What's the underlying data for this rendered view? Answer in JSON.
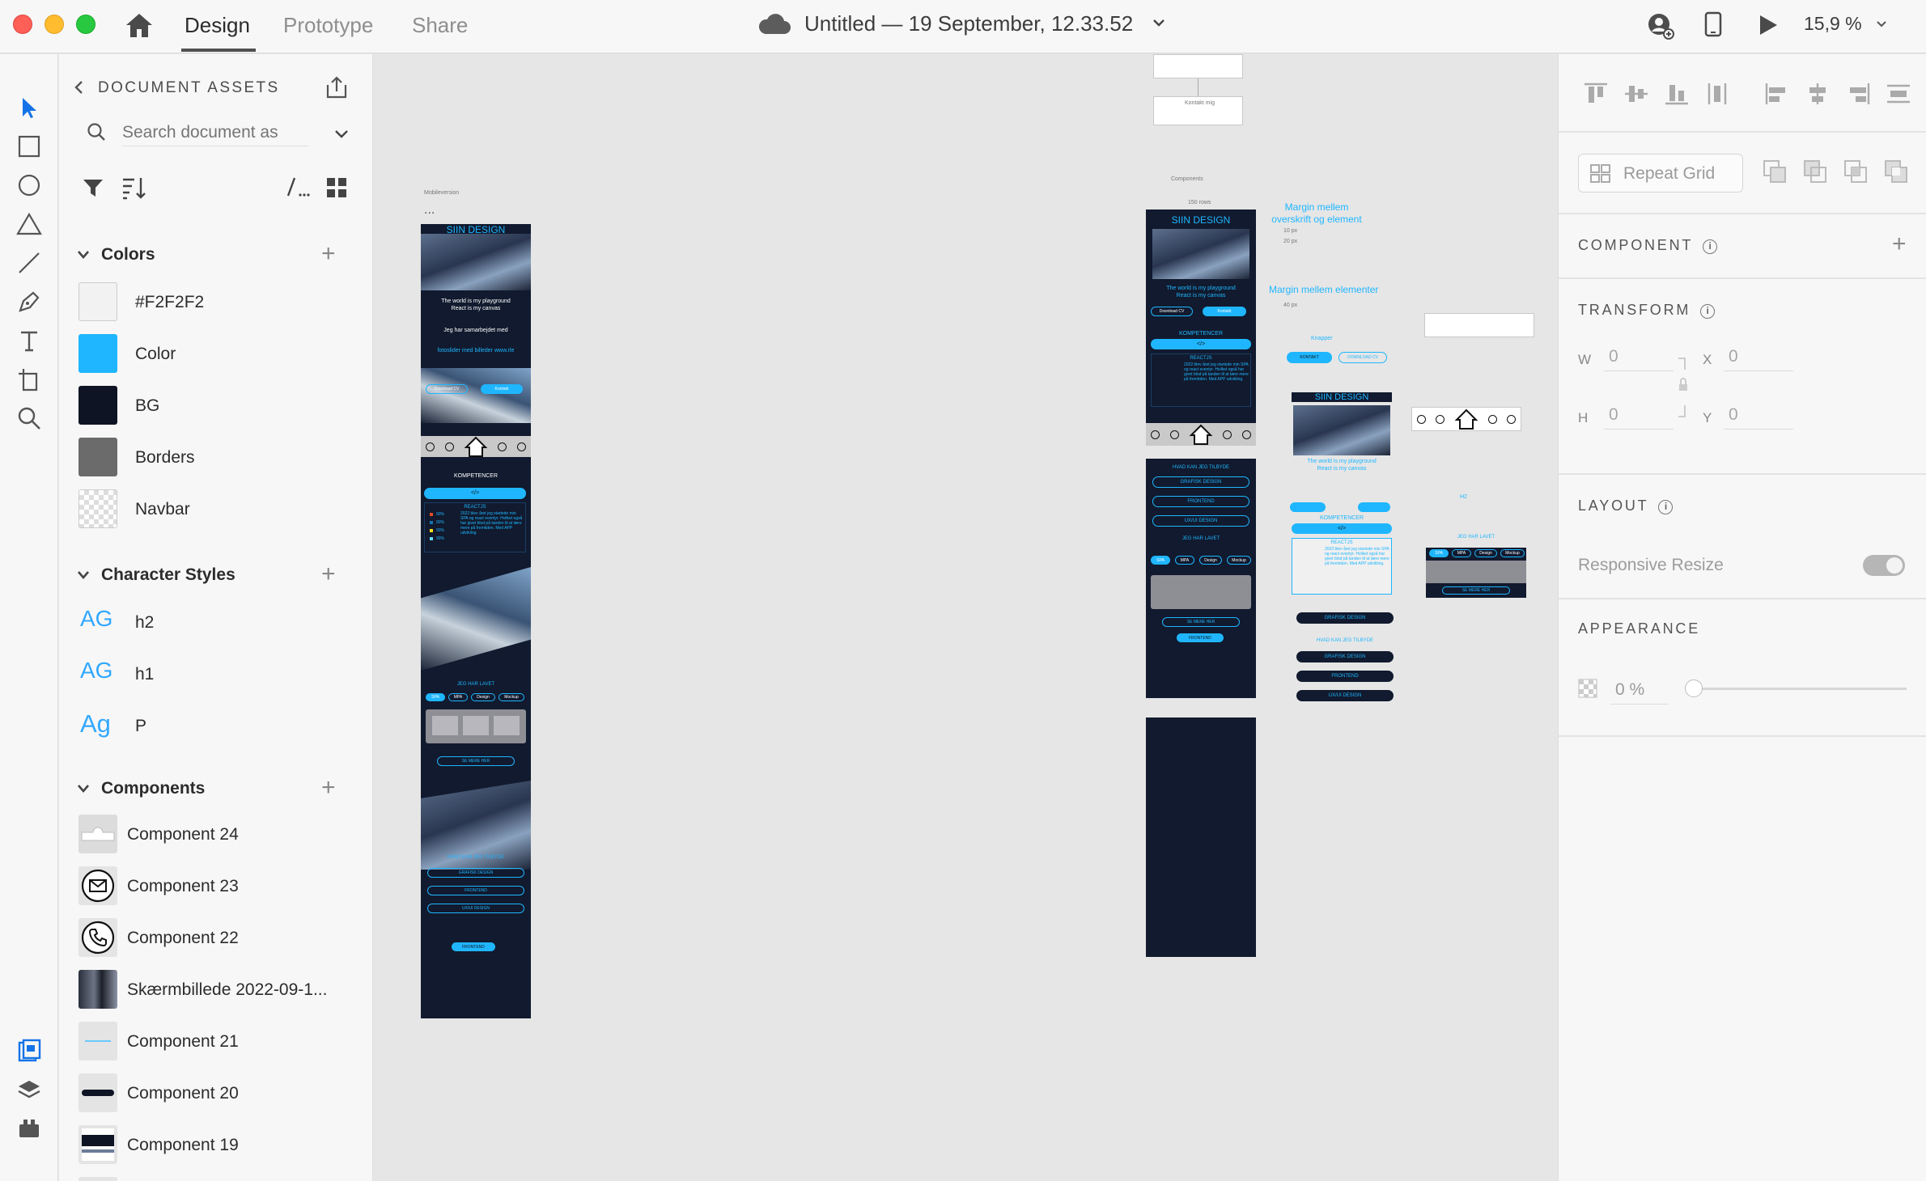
{
  "window": {
    "tabs": {
      "design": "Design",
      "prototype": "Prototype",
      "share": "Share"
    },
    "doc_title": "Untitled — 19 September, 12.33.52",
    "zoom": "15,9 %"
  },
  "toolbar": {
    "tools": [
      "select-arrow-icon",
      "rectangle-icon",
      "ellipse-icon",
      "polygon-icon",
      "line-icon",
      "pen-icon",
      "text-icon",
      "artboard-icon",
      "zoom-icon"
    ],
    "bottom": [
      "assets-icon",
      "layers-icon",
      "plugins-icon"
    ]
  },
  "assets": {
    "title": "DOCUMENT ASSETS",
    "search_placeholder": "Search document as",
    "colors": {
      "heading": "Colors",
      "items": [
        {
          "label": "#F2F2F2",
          "color": "#f2f2f2"
        },
        {
          "label": "Color",
          "color": "#1fb6ff"
        },
        {
          "label": "BG",
          "color": "#0f1424"
        },
        {
          "label": "Borders",
          "color": "#6b6b6b"
        },
        {
          "label": "Navbar",
          "color": "transparent"
        }
      ]
    },
    "character_styles": {
      "heading": "Character Styles",
      "items": [
        {
          "sample": "AG",
          "label": "h2"
        },
        {
          "sample": "AG",
          "label": "h1"
        },
        {
          "sample": "Ag",
          "label": "P"
        }
      ]
    },
    "components": {
      "heading": "Components",
      "items": [
        {
          "label": "Component 24",
          "thumb": "navbar-shape-icon"
        },
        {
          "label": "Component 23",
          "thumb": "mail-icon"
        },
        {
          "label": "Component 22",
          "thumb": "phone-icon"
        },
        {
          "label": "Skærmbillede 2022-09-1...",
          "thumb": "screenshot-thumbnail"
        },
        {
          "label": "Component 21",
          "thumb": "text-thumbnail"
        },
        {
          "label": "Component 20",
          "thumb": "bar-thumbnail"
        },
        {
          "label": "Component 19",
          "thumb": "page-thumbnail"
        }
      ]
    }
  },
  "canvas": {
    "labels": {
      "mobile_version": "Mobileversion",
      "components": "Components",
      "nav_small": "Kontakt mig",
      "comp_150": "150 rows",
      "ellipsis": "...",
      "margin_heading_1": "Margin mellem overskrift og element",
      "margin_heading_2": "Margin mellem elementer",
      "px_10": "10 px",
      "px_20": "20 px",
      "px_40": "40 px",
      "knapper": "Knapper",
      "h2_label": "H2"
    },
    "mobile": {
      "brand": "SIIN DESIGN",
      "tagline_1": "The world is my playground",
      "tagline_2": "React is my canvas",
      "collab": "Jeg har samarbejdet med",
      "slider_text": "fotoslider med billeder www.rle",
      "btn_download": "Download CV",
      "btn_contact": "Kontakt",
      "competencies": "KOMPETENCER",
      "code_symbol": "</>",
      "skill_title": "REACTJS",
      "skill_text": "2022 blev året jeg startede min SPA og react eventyr. Hvilket også har givet blod på tanden til at lære mere på fremtiden. Med APP udvikling.",
      "percent": "90%",
      "work_heading": "JEG HAR LAVET",
      "work_tabs": [
        "SPA",
        "MPA",
        "Design",
        "Mockup"
      ],
      "see_more": "SE MERE HER",
      "offer_heading": "HVAD KAN JEG TILBYDE",
      "offers": [
        "GRAFISK DESIGN",
        "FRONTEND",
        "UX/UI DESIGN"
      ],
      "footer_btn": "FRONTEND"
    },
    "buttons": {
      "primary": "KONTAKT",
      "secondary": "DOWNLOAD CV"
    }
  },
  "inspector": {
    "repeat_grid": "Repeat Grid",
    "component": "COMPONENT",
    "transform": "TRANSFORM",
    "w_label": "W",
    "w_value": "0",
    "h_label": "H",
    "h_value": "0",
    "x_label": "X",
    "x_value": "0",
    "y_label": "Y",
    "y_value": "0",
    "layout": "LAYOUT",
    "responsive_resize": "Responsive Resize",
    "appearance": "APPEARANCE",
    "opacity": "0 %"
  }
}
